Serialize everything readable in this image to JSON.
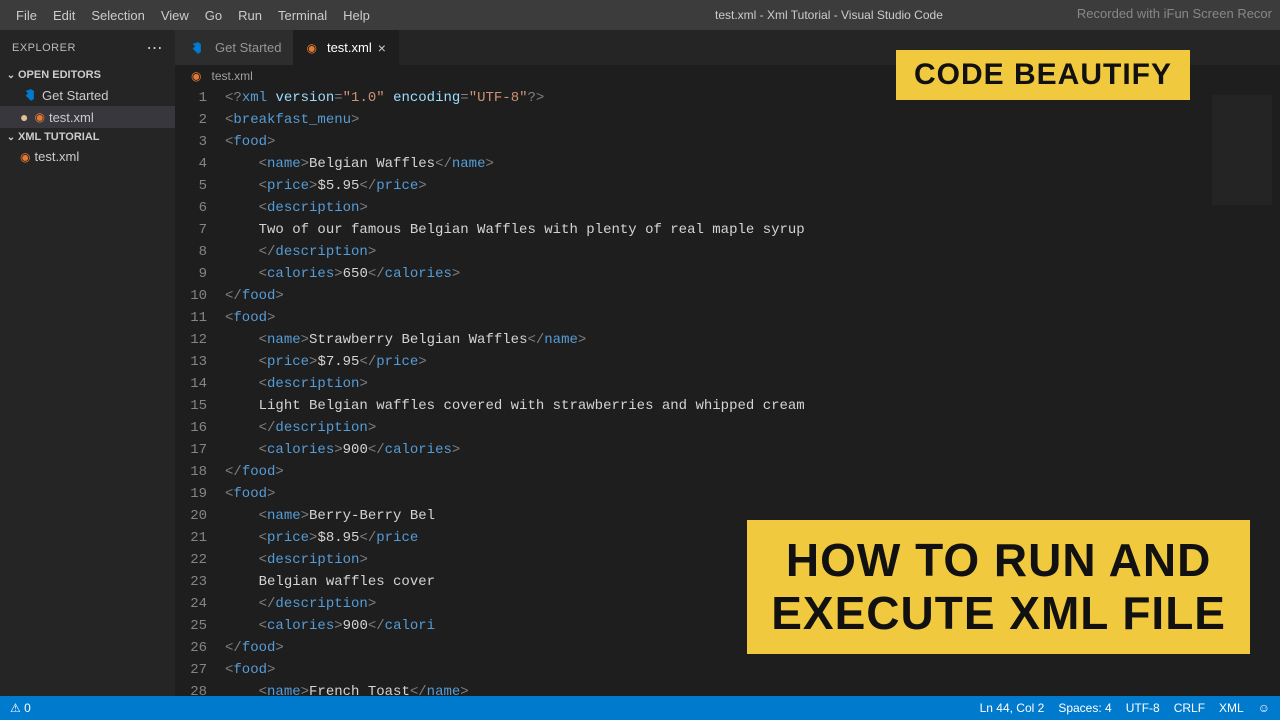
{
  "menubar": [
    "File",
    "Edit",
    "Selection",
    "View",
    "Go",
    "Run",
    "Terminal",
    "Help"
  ],
  "window_title": "test.xml - Xml Tutorial - Visual Studio Code",
  "watermark": "Recorded with iFun Screen Recor",
  "explorer": {
    "title": "EXPLORER",
    "sections": {
      "open_editors": {
        "label": "OPEN EDITORS",
        "items": [
          {
            "label": "Get Started",
            "icon": "vscode",
            "active": false,
            "dot": false
          },
          {
            "label": "test.xml",
            "icon": "rss",
            "active": true,
            "dot": true
          }
        ]
      },
      "workspace": {
        "label": "XML TUTORIAL",
        "items": [
          {
            "label": "test.xml",
            "icon": "rss",
            "active": false,
            "dot": false
          }
        ]
      }
    }
  },
  "tabs": [
    {
      "label": "Get Started",
      "icon": "vscode",
      "active": false,
      "closable": false
    },
    {
      "label": "test.xml",
      "icon": "rss",
      "active": true,
      "closable": true,
      "dot": true
    }
  ],
  "breadcrumb": {
    "icon": "rss",
    "label": "test.xml"
  },
  "code": [
    {
      "n": 1,
      "html": "<span class='tag-bracket'>&lt;?</span><span class='pi'>xml</span> <span class='attr-name'>version</span><span class='tag-bracket'>=</span><span class='attr-val'>\"1.0\"</span> <span class='attr-name'>encoding</span><span class='tag-bracket'>=</span><span class='attr-val'>\"UTF-8\"</span><span class='tag-bracket'>?&gt;</span>"
    },
    {
      "n": 2,
      "html": "<span class='tag-bracket'>&lt;</span><span class='tag-name'>breakfast_menu</span><span class='tag-bracket'>&gt;</span>"
    },
    {
      "n": 3,
      "html": "<span class='tag-bracket'>&lt;</span><span class='tag-name'>food</span><span class='tag-bracket'>&gt;</span>"
    },
    {
      "n": 4,
      "html": "    <span class='tag-bracket'>&lt;</span><span class='tag-name'>name</span><span class='tag-bracket'>&gt;</span><span class='text'>Belgian Waffles</span><span class='tag-bracket'>&lt;/</span><span class='tag-name'>name</span><span class='tag-bracket'>&gt;</span>"
    },
    {
      "n": 5,
      "html": "    <span class='tag-bracket'>&lt;</span><span class='tag-name'>price</span><span class='tag-bracket'>&gt;</span><span class='text'>$5.95</span><span class='tag-bracket'>&lt;/</span><span class='tag-name'>price</span><span class='tag-bracket'>&gt;</span>"
    },
    {
      "n": 6,
      "html": "    <span class='tag-bracket'>&lt;</span><span class='tag-name'>description</span><span class='tag-bracket'>&gt;</span>"
    },
    {
      "n": 7,
      "html": "    <span class='text'>Two of our famous Belgian Waffles with plenty of real maple syrup</span>"
    },
    {
      "n": 8,
      "html": "    <span class='tag-bracket'>&lt;/</span><span class='tag-name'>description</span><span class='tag-bracket'>&gt;</span>"
    },
    {
      "n": 9,
      "html": "    <span class='tag-bracket'>&lt;</span><span class='tag-name'>calories</span><span class='tag-bracket'>&gt;</span><span class='text'>650</span><span class='tag-bracket'>&lt;/</span><span class='tag-name'>calories</span><span class='tag-bracket'>&gt;</span>"
    },
    {
      "n": 10,
      "html": "<span class='tag-bracket'>&lt;/</span><span class='tag-name'>food</span><span class='tag-bracket'>&gt;</span>"
    },
    {
      "n": 11,
      "html": "<span class='tag-bracket'>&lt;</span><span class='tag-name'>food</span><span class='tag-bracket'>&gt;</span>"
    },
    {
      "n": 12,
      "html": "    <span class='tag-bracket'>&lt;</span><span class='tag-name'>name</span><span class='tag-bracket'>&gt;</span><span class='text'>Strawberry Belgian Waffles</span><span class='tag-bracket'>&lt;/</span><span class='tag-name'>name</span><span class='tag-bracket'>&gt;</span>"
    },
    {
      "n": 13,
      "html": "    <span class='tag-bracket'>&lt;</span><span class='tag-name'>price</span><span class='tag-bracket'>&gt;</span><span class='text'>$7.95</span><span class='tag-bracket'>&lt;/</span><span class='tag-name'>price</span><span class='tag-bracket'>&gt;</span>"
    },
    {
      "n": 14,
      "html": "    <span class='tag-bracket'>&lt;</span><span class='tag-name'>description</span><span class='tag-bracket'>&gt;</span>"
    },
    {
      "n": 15,
      "html": "    <span class='text'>Light Belgian waffles covered with strawberries and whipped cream</span>"
    },
    {
      "n": 16,
      "html": "    <span class='tag-bracket'>&lt;/</span><span class='tag-name'>description</span><span class='tag-bracket'>&gt;</span>"
    },
    {
      "n": 17,
      "html": "    <span class='tag-bracket'>&lt;</span><span class='tag-name'>calories</span><span class='tag-bracket'>&gt;</span><span class='text'>900</span><span class='tag-bracket'>&lt;/</span><span class='tag-name'>calories</span><span class='tag-bracket'>&gt;</span>"
    },
    {
      "n": 18,
      "html": "<span class='tag-bracket'>&lt;/</span><span class='tag-name'>food</span><span class='tag-bracket'>&gt;</span>"
    },
    {
      "n": 19,
      "html": "<span class='tag-bracket'>&lt;</span><span class='tag-name'>food</span><span class='tag-bracket'>&gt;</span>"
    },
    {
      "n": 20,
      "html": "    <span class='tag-bracket'>&lt;</span><span class='tag-name'>name</span><span class='tag-bracket'>&gt;</span><span class='text'>Berry-Berry Bel</span>"
    },
    {
      "n": 21,
      "html": "    <span class='tag-bracket'>&lt;</span><span class='tag-name'>price</span><span class='tag-bracket'>&gt;</span><span class='text'>$8.95</span><span class='tag-bracket'>&lt;/</span><span class='tag-name'>price</span>"
    },
    {
      "n": 22,
      "html": "    <span class='tag-bracket'>&lt;</span><span class='tag-name'>description</span><span class='tag-bracket'>&gt;</span>"
    },
    {
      "n": 23,
      "html": "    <span class='text'>Belgian waffles cover</span>"
    },
    {
      "n": 24,
      "html": "    <span class='tag-bracket'>&lt;/</span><span class='tag-name'>description</span><span class='tag-bracket'>&gt;</span>"
    },
    {
      "n": 25,
      "html": "    <span class='tag-bracket'>&lt;</span><span class='tag-name'>calories</span><span class='tag-bracket'>&gt;</span><span class='text'>900</span><span class='tag-bracket'>&lt;/</span><span class='tag-name'>calori</span>"
    },
    {
      "n": 26,
      "html": "<span class='tag-bracket'>&lt;/</span><span class='tag-name'>food</span><span class='tag-bracket'>&gt;</span>"
    },
    {
      "n": 27,
      "html": "<span class='tag-bracket'>&lt;</span><span class='tag-name'>food</span><span class='tag-bracket'>&gt;</span>"
    },
    {
      "n": 28,
      "html": "    <span class='tag-bracket'>&lt;</span><span class='tag-name'>name</span><span class='tag-bracket'>&gt;</span><span class='text'>French Toast</span><span class='tag-bracket'>&lt;/</span><span class='tag-name'>name</span><span class='tag-bracket'>&gt;</span>"
    }
  ],
  "statusbar": {
    "errors": "0",
    "warnings": "0",
    "ln_col": "Ln 44, Col 2",
    "spaces": "Spaces: 4",
    "encoding": "UTF-8",
    "eol": "CRLF",
    "lang": "XML"
  },
  "overlays": {
    "brand": "CODE BEAUTIFY",
    "title": "HOW TO RUN AND\nEXECUTE XML FILE"
  }
}
